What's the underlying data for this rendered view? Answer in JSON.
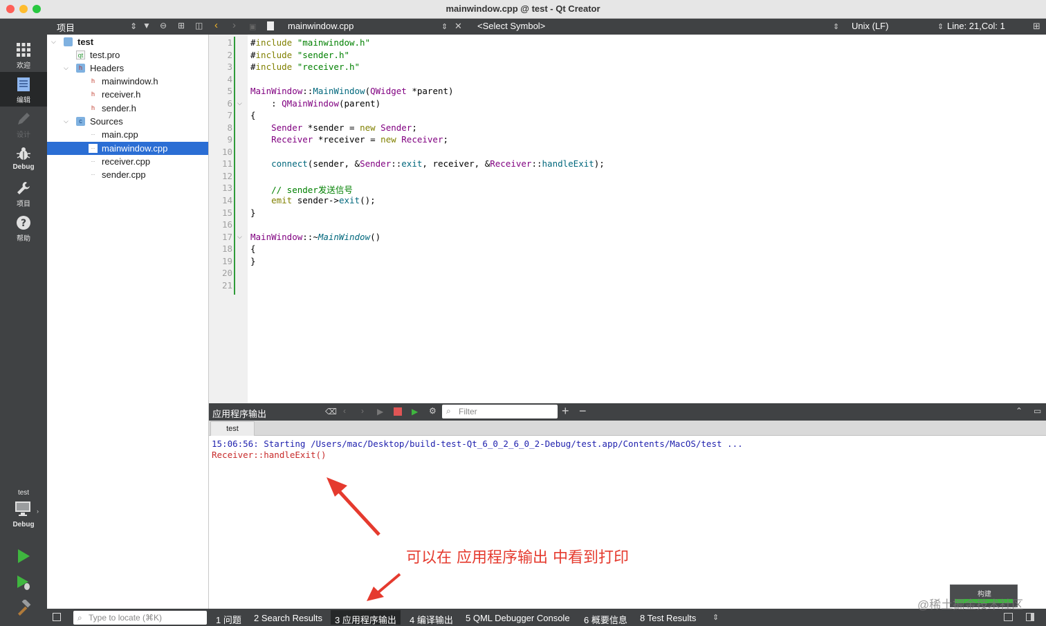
{
  "window": {
    "title": "mainwindow.cpp @ test - Qt Creator"
  },
  "modebar": {
    "modes": [
      {
        "label": "欢迎",
        "icon": "grid-icon"
      },
      {
        "label": "编辑",
        "icon": "edit-icon"
      },
      {
        "label": "设计",
        "icon": "pencil-icon"
      },
      {
        "label": "Debug",
        "icon": "bug-icon"
      },
      {
        "label": "项目",
        "icon": "wrench-icon"
      },
      {
        "label": "帮助",
        "icon": "help-icon"
      }
    ],
    "kit": {
      "project": "test",
      "build": "Debug"
    }
  },
  "project_pane": {
    "title": "项目",
    "tree": [
      {
        "label": "test",
        "icon": "project-folder-icon"
      },
      {
        "label": "test.pro",
        "icon": "pro-file-icon"
      },
      {
        "label": "Headers",
        "icon": "headers-folder-icon"
      },
      {
        "label": "mainwindow.h",
        "icon": "header-file-icon"
      },
      {
        "label": "receiver.h",
        "icon": "header-file-icon"
      },
      {
        "label": "sender.h",
        "icon": "header-file-icon"
      },
      {
        "label": "Sources",
        "icon": "sources-folder-icon"
      },
      {
        "label": "main.cpp",
        "icon": "cpp-file-icon"
      },
      {
        "label": "mainwindow.cpp",
        "icon": "cpp-file-icon"
      },
      {
        "label": "receiver.cpp",
        "icon": "cpp-file-icon"
      },
      {
        "label": "sender.cpp",
        "icon": "cpp-file-icon"
      }
    ],
    "selected": "mainwindow.cpp"
  },
  "editor": {
    "file": "mainwindow.cpp",
    "symbol": "<Select Symbol>",
    "line_ending": "Unix (LF)",
    "cursor": "Line: 21,Col: 1",
    "line_numbers": [
      "1",
      "2",
      "3",
      "4",
      "5",
      "6",
      "7",
      "8",
      "9",
      "10",
      "11",
      "12",
      "13",
      "14",
      "15",
      "16",
      "17",
      "18",
      "19",
      "20",
      "21"
    ],
    "lines": [
      "#include \"mainwindow.h\"",
      "#include \"sender.h\"",
      "#include \"receiver.h\"",
      "",
      "MainWindow::MainWindow(QWidget *parent)",
      "    : QMainWindow(parent)",
      "{",
      "    Sender *sender = new Sender;",
      "    Receiver *receiver = new Receiver;",
      "",
      "    connect(sender, &Sender::exit, receiver, &Receiver::handleExit);",
      "",
      "    // sender发送信号",
      "    emit sender->exit();",
      "}",
      "",
      "MainWindow::~MainWindow()",
      "{",
      "}",
      "",
      ""
    ]
  },
  "output_pane": {
    "title": "应用程序输出",
    "filter_placeholder": "Filter",
    "tab": "test",
    "lines": [
      "15:06:56: Starting /Users/mac/Desktop/build-test-Qt_6_0_2_6_0_2-Debug/test.app/Contents/MacOS/test ...",
      "Receiver::handleExit()"
    ],
    "line_colors": [
      "#1d1fad",
      "#c72a2a"
    ]
  },
  "annotation": {
    "text": "可以在 应用程序输出 中看到打印",
    "color": "#e53a2e"
  },
  "statusbar": {
    "locate_placeholder": "Type to locate (⌘K)",
    "tabs": [
      "1  问题",
      "2  Search Results",
      "3  应用程序输出",
      "4  编译输出",
      "5  QML Debugger Console",
      "6  概要信息",
      "8  Test Results"
    ],
    "build_label": "构建"
  },
  "watermark": "@稀土掘金技术社区"
}
